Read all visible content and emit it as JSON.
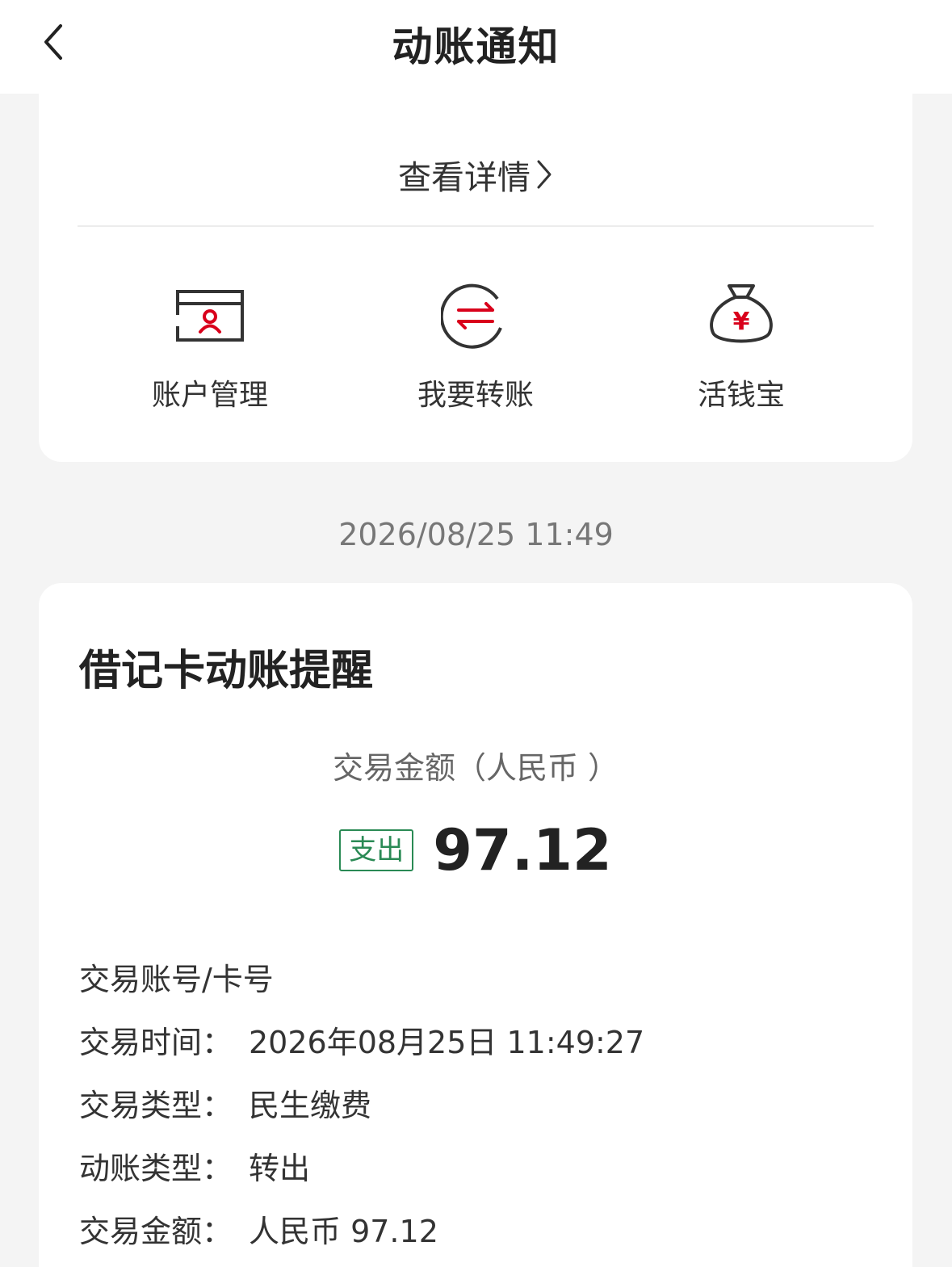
{
  "header": {
    "title": "动账通知",
    "back_icon": "chevron-left-icon"
  },
  "top_card": {
    "detail_link": "查看详情",
    "shortcuts": [
      {
        "label": "账户管理",
        "icon": "account-card-icon"
      },
      {
        "label": "我要转账",
        "icon": "transfer-icon"
      },
      {
        "label": "活钱宝",
        "icon": "money-bag-icon"
      }
    ]
  },
  "timestamp": "2026/08/25 11:49",
  "notice": {
    "title": "借记卡动账提醒",
    "amount_caption": "交易金额（人民币 ）",
    "badge": "支出",
    "amount": "97.12",
    "details": [
      {
        "label": "交易账号/卡号",
        "value": ""
      },
      {
        "label": "交易时间：",
        "value": "2026年08月25日 11:49:27"
      },
      {
        "label": "交易类型：",
        "value": "民生缴费"
      },
      {
        "label": "动账类型：",
        "value": "转出"
      },
      {
        "label": "交易金额：",
        "value": "人民币 97.12"
      }
    ]
  },
  "colors": {
    "accent_red": "#d9001b",
    "badge_green": "#2a8a55",
    "background": "#f4f4f4"
  }
}
